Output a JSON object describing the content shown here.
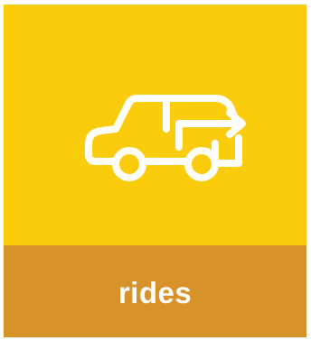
{
  "tile": {
    "label": "rides",
    "icon": "car-arrow-icon",
    "colors": {
      "top": "#FBCC0C",
      "bottom": "#D7922A",
      "icon": "#FFFFFF",
      "text": "#FFFFFF"
    }
  }
}
